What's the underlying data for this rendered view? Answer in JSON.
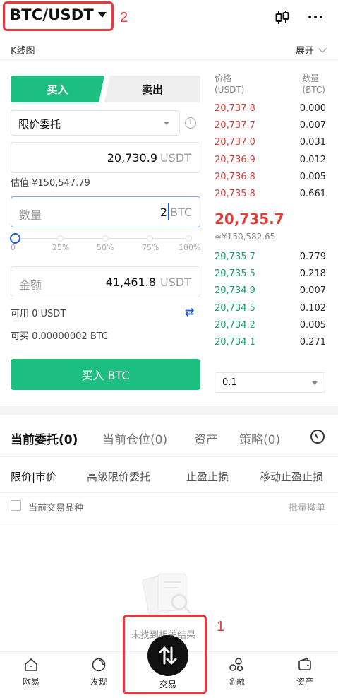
{
  "header": {
    "pair": "BTC/USDT",
    "more_icon": "more-horizontal-icon",
    "chart_icon": "candlestick-icon",
    "kline_label": "K线图",
    "expand_label": "展开"
  },
  "trade_panel": {
    "buy_tab": "买入",
    "sell_tab": "卖出",
    "order_type": "限价委托",
    "price": {
      "value": "20,730.9",
      "unit": "USDT"
    },
    "valuation": "估值 ¥150,547.79",
    "quantity": {
      "placeholder": "数量",
      "value": "2",
      "unit": "BTC"
    },
    "slider": {
      "level_percent": 0,
      "marks": [
        "0",
        "25%",
        "50%",
        "75%",
        "100%"
      ]
    },
    "amount": {
      "placeholder": "金额",
      "value": "41,461.8",
      "unit": "USDT"
    },
    "available": "可用 0 USDT",
    "can_buy": "可买 0.00000002 BTC",
    "buy_button": "买入 BTC"
  },
  "orderbook": {
    "price_header": "价格",
    "price_unit": "(USDT)",
    "qty_header": "数量",
    "qty_unit": "(BTC)",
    "asks": [
      {
        "price": "20,737.8",
        "qty": "0.000"
      },
      {
        "price": "20,737.7",
        "qty": "0.007"
      },
      {
        "price": "20,737.0",
        "qty": "0.031"
      },
      {
        "price": "20,736.9",
        "qty": "0.012"
      },
      {
        "price": "20,736.8",
        "qty": "0.005"
      },
      {
        "price": "20,735.8",
        "qty": "0.661"
      }
    ],
    "last_price": "20,735.7",
    "last_price_cny": "≈¥150,582.65",
    "bids": [
      {
        "price": "20,735.7",
        "qty": "0.779"
      },
      {
        "price": "20,735.5",
        "qty": "0.218"
      },
      {
        "price": "20,734.9",
        "qty": "0.007"
      },
      {
        "price": "20,734.5",
        "qty": "0.102"
      },
      {
        "price": "20,734.2",
        "qty": "0.005"
      },
      {
        "price": "20,734.1",
        "qty": "0.271"
      }
    ],
    "depth": "0.1"
  },
  "orders": {
    "tabs": [
      "当前委托(0)",
      "当前仓位(0)",
      "资产",
      "策略(0)"
    ],
    "subtabs": [
      "限价|市价",
      "高级限价委托",
      "止盈止损",
      "移动止盈止损"
    ],
    "filter_label": "当前交易品种",
    "batch_cancel": "批量撤单",
    "empty_text": "未找到相关结果"
  },
  "nav": {
    "items": [
      {
        "label": "欧易",
        "icon": "home-icon"
      },
      {
        "label": "发现",
        "icon": "discover-icon"
      },
      {
        "label": "交易",
        "icon": "trade-icon"
      },
      {
        "label": "金融",
        "icon": "finance-icon"
      },
      {
        "label": "资产",
        "icon": "wallet-icon"
      }
    ]
  },
  "annotations": {
    "one": "1",
    "two": "2"
  },
  "colors": {
    "buy": "#1dbf80",
    "sell_price": "#d9403a",
    "accent": "#1c5fd0",
    "annotation": "#e8383d"
  }
}
